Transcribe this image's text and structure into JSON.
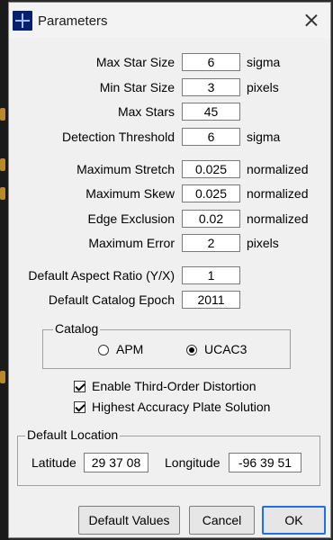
{
  "window": {
    "title": "Parameters"
  },
  "fields": [
    {
      "label": "Max Star Size",
      "value": "6",
      "unit": "sigma"
    },
    {
      "label": "Min Star Size",
      "value": "3",
      "unit": "pixels"
    },
    {
      "label": "Max Stars",
      "value": "45",
      "unit": ""
    },
    {
      "label": "Detection Threshold",
      "value": "6",
      "unit": "sigma"
    },
    {
      "label": "Maximum Stretch",
      "value": "0.025",
      "unit": "normalized"
    },
    {
      "label": "Maximum Skew",
      "value": "0.025",
      "unit": "normalized"
    },
    {
      "label": "Edge Exclusion",
      "value": "0.02",
      "unit": "normalized"
    },
    {
      "label": "Maximum Error",
      "value": "2",
      "unit": "pixels"
    },
    {
      "label": "Default Aspect Ratio (Y/X)",
      "value": "1",
      "unit": ""
    },
    {
      "label": "Default Catalog Epoch",
      "value": "2011",
      "unit": ""
    }
  ],
  "catalog": {
    "legend": "Catalog",
    "options": [
      {
        "label": "APM",
        "selected": false
      },
      {
        "label": "UCAC3",
        "selected": true
      }
    ]
  },
  "checkboxes": [
    {
      "label": "Enable Third-Order Distortion",
      "checked": true
    },
    {
      "label": "Highest Accuracy Plate Solution",
      "checked": true
    }
  ],
  "location": {
    "legend": "Default Location",
    "latitude_label": "Latitude",
    "latitude": "29 37 08",
    "longitude_label": "Longitude",
    "longitude": "-96 39 51"
  },
  "buttons": {
    "defaults": "Default Values",
    "cancel": "Cancel",
    "ok": "OK"
  }
}
